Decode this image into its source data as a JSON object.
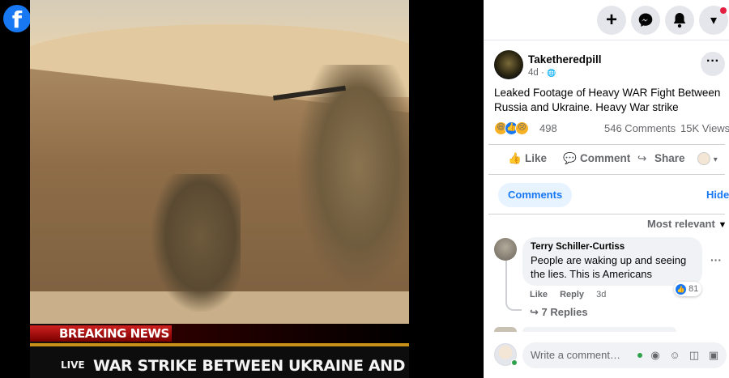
{
  "brand": {
    "logo_glyph": "f",
    "color": "#1877f2"
  },
  "video": {
    "banner": "BREAKING NEWS",
    "live": "LIVE",
    "headline": "WAR STRIKE BETWEEN UKRAINE AND RUSSIA"
  },
  "topbar": {
    "buttons": [
      {
        "icon": "plus-icon",
        "glyph": "+"
      },
      {
        "icon": "messenger-icon",
        "glyph": "✉"
      },
      {
        "icon": "bell-icon",
        "glyph": "🔔"
      },
      {
        "icon": "account-chevron-icon",
        "glyph": "▾"
      }
    ]
  },
  "post": {
    "author": "Taketheredpill",
    "time": "4d ·",
    "audience_glyph": "🌐",
    "text": "Leaked Footage of Heavy WAR Fight Between Russia and Ukraine. Heavy War strike",
    "reaction_count": "498",
    "comments_count": "546 Comments",
    "views_count": "15K Views"
  },
  "actions": {
    "like": "Like",
    "comment": "Comment",
    "share": "Share"
  },
  "comments_section": {
    "tab": "Comments",
    "hide": "Hide",
    "sort": "Most relevant",
    "items": [
      {
        "name": "Terry Schiller-Curtiss",
        "text": "People are waking up and seeing the lies. This is Americans",
        "reactions": "81",
        "like": "Like",
        "reply": "Reply",
        "time": "3d",
        "replies": "7 Replies"
      }
    ]
  },
  "composer": {
    "placeholder": "Write a comment…"
  }
}
